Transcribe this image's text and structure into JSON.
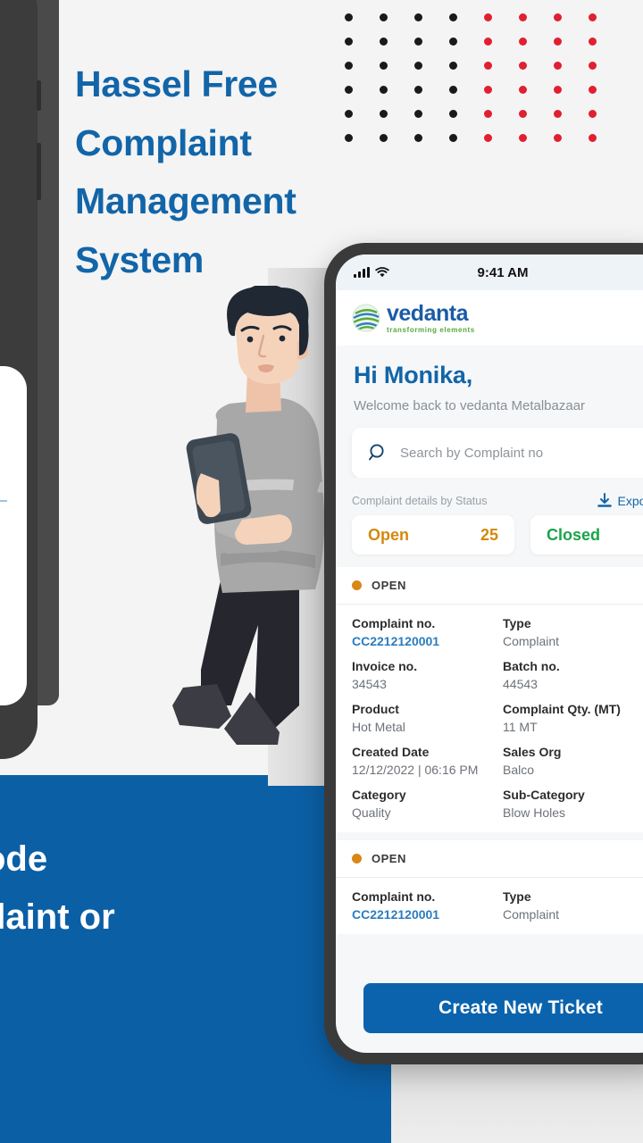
{
  "hero": {
    "headline_lines": [
      "Hassel Free",
      "Complaint",
      "Management",
      "System"
    ],
    "headline_color": "#1265a8",
    "background_color": "#f4f4f4"
  },
  "dot_grid": {
    "rows": 7,
    "cols": 8,
    "black_cols": 4,
    "red_cols": 4,
    "black_color": "#1a1a1a",
    "red_color": "#e02030"
  },
  "illustration": {
    "name": "man-leaning-holding-phone",
    "skin": "#f5d3bb",
    "hair": "#1f2833",
    "shirt": "#a8a8a8",
    "pants": "#25262e",
    "shoes": "#3c3c44"
  },
  "blue_panel": {
    "background_color": "#0b5fa5",
    "lines": [
      "QR Code",
      "Complaint or"
    ]
  },
  "phone": {
    "status_bar": {
      "time": "9:41 AM",
      "signal_icon": "cellular-bars-icon",
      "wifi_icon": "wifi-icon",
      "bluetooth_icon": "bluetooth-icon"
    },
    "app_bar": {
      "logo_word": "vedanta",
      "logo_tagline": "transforming elements",
      "logo_icon": "vedanta-globe-icon",
      "word_color": "#1a5ba6",
      "tagline_color": "#5aa83b"
    },
    "greeting": {
      "title": "Hi Monika,",
      "subtitle": "Welcome back to vedanta Metalbazaar"
    },
    "search": {
      "placeholder": "Search by Complaint no",
      "icon": "search-icon",
      "value": ""
    },
    "status_section": {
      "label": "Complaint details by Status",
      "export_label": "Export",
      "export_icon": "download-icon",
      "chips": [
        {
          "label": "Open",
          "count": "25",
          "color": "#d4890c"
        },
        {
          "label": "Closed",
          "count": "",
          "color": "#1aa34a"
        }
      ]
    },
    "cards": [
      {
        "status": "OPEN",
        "status_color": "#d98715",
        "fields": [
          {
            "key": "Complaint no.",
            "value": "CC2212120001",
            "is_link": true
          },
          {
            "key": "Type",
            "value": "Complaint",
            "is_link": false
          },
          {
            "key": "Invoice no.",
            "value": "34543",
            "is_link": false
          },
          {
            "key": "Batch no.",
            "value": "44543",
            "is_link": false
          },
          {
            "key": "Product",
            "value": "Hot Metal",
            "is_link": false
          },
          {
            "key": "Complaint Qty. (MT)",
            "value": "11 MT",
            "is_link": false
          },
          {
            "key": "Created Date",
            "value": "12/12/2022 | 06:16 PM",
            "is_link": false
          },
          {
            "key": "Sales Org",
            "value": "Balco",
            "is_link": false
          },
          {
            "key": "Category",
            "value": "Quality",
            "is_link": false
          },
          {
            "key": "Sub-Category",
            "value": "Blow Holes",
            "is_link": false
          }
        ]
      },
      {
        "status": "OPEN",
        "status_color": "#d98715",
        "fields": [
          {
            "key": "Complaint no.",
            "value": "CC2212120001",
            "is_link": true
          },
          {
            "key": "Type",
            "value": "Complaint",
            "is_link": false
          }
        ]
      }
    ],
    "cta": {
      "label": "Create New Ticket",
      "color": "#0b63ad"
    }
  }
}
